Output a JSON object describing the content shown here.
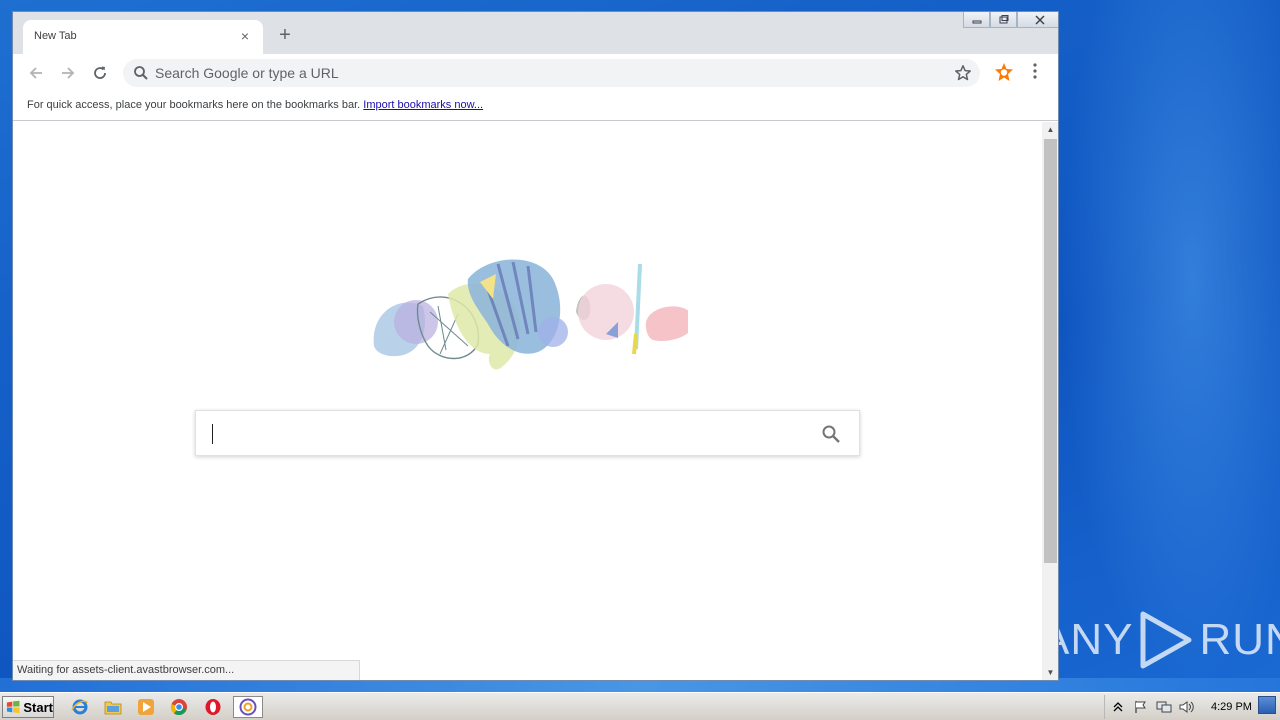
{
  "browser": {
    "tab": {
      "title": "New Tab",
      "close_symbol": "×"
    },
    "new_tab_symbol": "+",
    "window_controls": {
      "minimize": "▭",
      "restore": "❐",
      "close": "✕"
    },
    "omnibox": {
      "placeholder": "Search Google or type a URL",
      "value": ""
    },
    "bookmarks_bar": {
      "text": "For quick access, place your bookmarks here on the bookmarks bar.",
      "link": "Import bookmarks now..."
    },
    "page": {
      "search_value": ""
    },
    "status": "Waiting for assets-client.avastbrowser.com...",
    "colors": {
      "accent": "#ff7800",
      "link": "#1a0dab"
    }
  },
  "taskbar": {
    "start_label": "Start",
    "apps": [
      "internet-explorer-icon",
      "file-explorer-icon",
      "media-player-icon",
      "chrome-icon",
      "opera-icon",
      "avast-browser-icon"
    ],
    "clock": "4:29 PM"
  },
  "watermark": {
    "text_left": "ANY",
    "text_right": "RUN"
  }
}
